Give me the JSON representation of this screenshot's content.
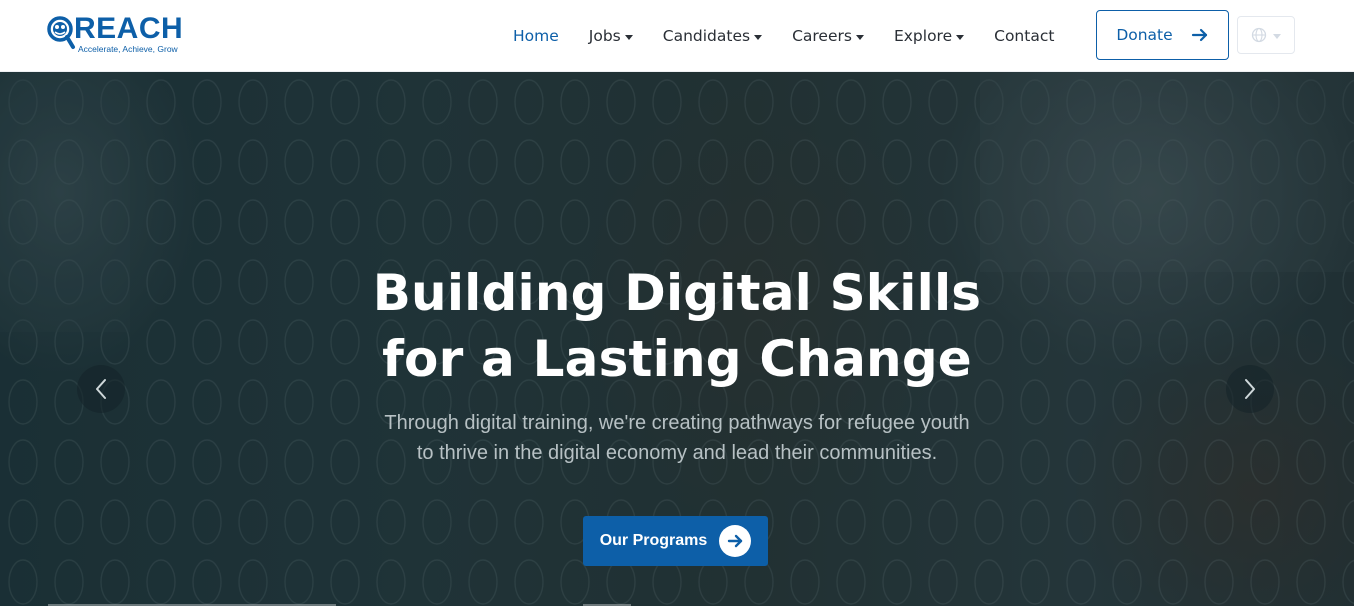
{
  "brand": {
    "name": "REACH",
    "tagline": "Accelerate, Achieve, Grow",
    "color": "#0d5fa8"
  },
  "nav": {
    "items": [
      {
        "label": "Home",
        "active": true,
        "dropdown": false
      },
      {
        "label": "Jobs",
        "active": false,
        "dropdown": true
      },
      {
        "label": "Candidates",
        "active": false,
        "dropdown": true
      },
      {
        "label": "Careers",
        "active": false,
        "dropdown": true
      },
      {
        "label": "Explore",
        "active": false,
        "dropdown": true
      },
      {
        "label": "Contact",
        "active": false,
        "dropdown": false
      }
    ],
    "donate_label": "Donate",
    "language_icon": "globe-icon"
  },
  "hero": {
    "title_line1": "Building Digital Skills",
    "title_line2": "for a Lasting Change",
    "subtitle_line1": "Through digital training, we're creating pathways for refugee youth",
    "subtitle_line2": "to thrive in the digital economy and lead their communities.",
    "cta_label": "Our Programs",
    "prev_icon": "chevron-left-icon",
    "next_icon": "chevron-right-icon"
  },
  "colors": {
    "primary": "#0d5fa8",
    "nav_text": "#2a2f36",
    "hero_overlay": "#1f3338"
  }
}
